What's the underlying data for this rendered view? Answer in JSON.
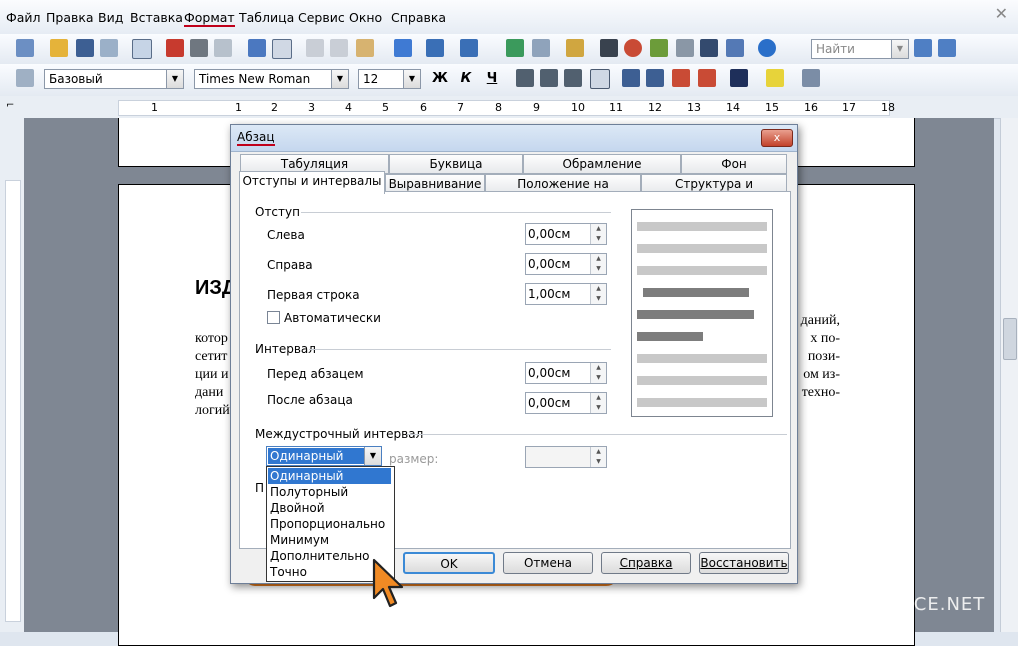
{
  "menu": [
    "Файл",
    "Правка",
    "Вид",
    "Вставка",
    "Формат",
    "Таблица",
    "Сервис",
    "Окно",
    "Справка"
  ],
  "menu_active": "Формат",
  "toolbar_find": {
    "placeholder": "Найти"
  },
  "format_bar": {
    "style": "Базовый",
    "font": "Times New Roman",
    "size": "12",
    "bold": "Ж",
    "italic": "К",
    "underline": "Ч"
  },
  "ruler_numbers": [
    "1",
    "1",
    "2",
    "3",
    "4",
    "5",
    "6",
    "7",
    "8",
    "9",
    "10",
    "11",
    "12",
    "13",
    "14",
    "15",
    "16",
    "17",
    "18"
  ],
  "document": {
    "heading": "ИЗД",
    "left_col": [
      "котор",
      "сетит",
      "ции и",
      "дани",
      "логий"
    ],
    "right_col": [
      "даний,",
      "х по-",
      "пози-",
      "ом из-",
      "техно-"
    ]
  },
  "dialog": {
    "title": "Абзац",
    "close": "x",
    "tabs_row1": [
      "Табуляция",
      "Буквица",
      "Обрамление",
      "Фон"
    ],
    "tabs_row2": [
      "Отступы и интервалы",
      "Выравнивание",
      "Положение на странице",
      "Структура и нумерация"
    ],
    "indent": {
      "group": "Отступ",
      "left_label": "Слева",
      "left_value": "0,00см",
      "right_label": "Справа",
      "right_value": "0,00см",
      "first_label": "Первая строка",
      "first_value": "1,00см",
      "auto_label": "Автоматически"
    },
    "spacing": {
      "group": "Интервал",
      "before_label": "Перед абзацем",
      "before_value": "0,00см",
      "after_label": "После абзаца",
      "after_value": "0,00см"
    },
    "line_spacing": {
      "group": "Междустрочный интервал",
      "selected": "Одинарный",
      "size_label": "размер:",
      "options": [
        "Одинарный",
        "Полуторный",
        "Двойной",
        "Пропорционально",
        "Минимум",
        "Дополнительно",
        "Точно"
      ],
      "partial_label": "П"
    },
    "buttons": {
      "ok": "OK",
      "cancel": "Отмена",
      "help": "Справка",
      "reset": "Восстановить"
    }
  },
  "watermark": "FREE-OFFICE.NET",
  "colors": {
    "accent": "#e07a1f",
    "selection": "#3077d0",
    "underline": "#c0001a"
  }
}
